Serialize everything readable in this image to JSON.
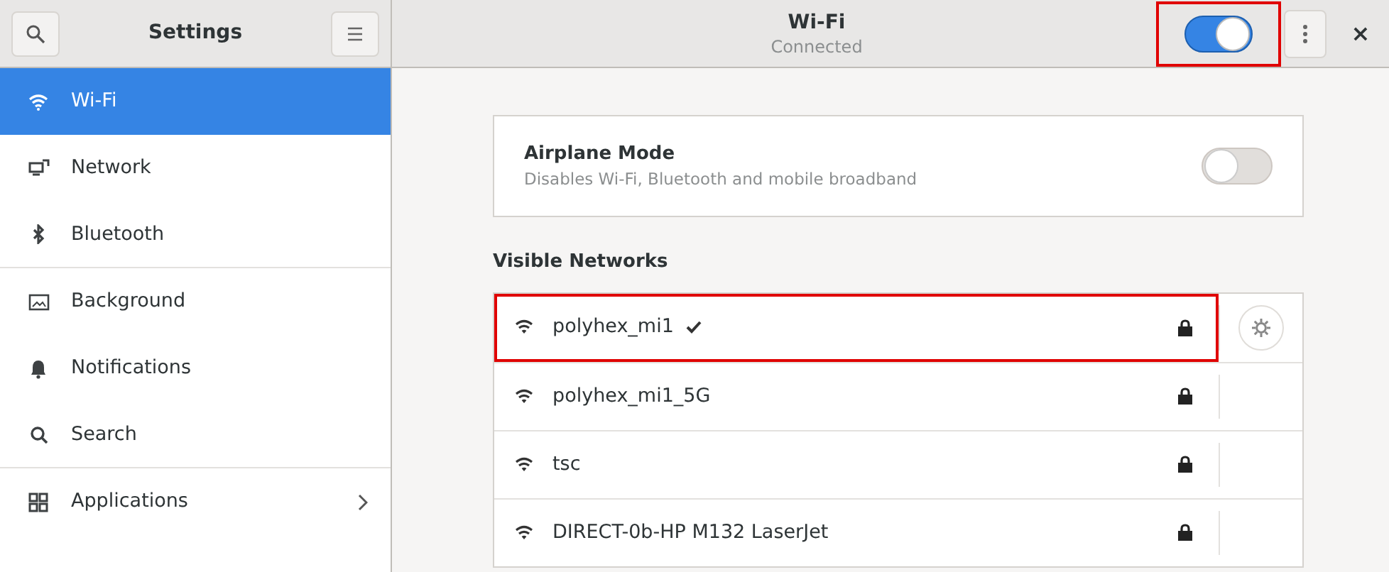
{
  "sidebar_header": {
    "title": "Settings"
  },
  "header": {
    "title": "Wi-Fi",
    "subtitle": "Connected",
    "wifi_on": true,
    "toggle_highlighted": true,
    "close": "×"
  },
  "sidebar": {
    "items": [
      {
        "label": "Wi-Fi",
        "selected": true,
        "has_arrow": false,
        "separator_after": false
      },
      {
        "label": "Network",
        "selected": false,
        "has_arrow": false,
        "separator_after": false
      },
      {
        "label": "Bluetooth",
        "selected": false,
        "has_arrow": false,
        "separator_after": true
      },
      {
        "label": "Background",
        "selected": false,
        "has_arrow": false,
        "separator_after": false
      },
      {
        "label": "Notifications",
        "selected": false,
        "has_arrow": false,
        "separator_after": false
      },
      {
        "label": "Search",
        "selected": false,
        "has_arrow": false,
        "separator_after": true
      },
      {
        "label": "Applications",
        "selected": false,
        "has_arrow": true,
        "separator_after": false
      }
    ]
  },
  "airplane_mode": {
    "title": "Airplane Mode",
    "description": "Disables Wi-Fi, Bluetooth and mobile broadband",
    "on": false
  },
  "visible_networks": {
    "heading": "Visible Networks",
    "networks": [
      {
        "name": "polyhex_mi1",
        "connected": true,
        "secured": true,
        "highlighted": true
      },
      {
        "name": "polyhex_mi1_5G",
        "connected": false,
        "secured": true,
        "highlighted": false
      },
      {
        "name": "tsc",
        "connected": false,
        "secured": true,
        "highlighted": false
      },
      {
        "name": "DIRECT-0b-HP M132 LaserJet",
        "connected": false,
        "secured": true,
        "highlighted": false
      }
    ]
  }
}
